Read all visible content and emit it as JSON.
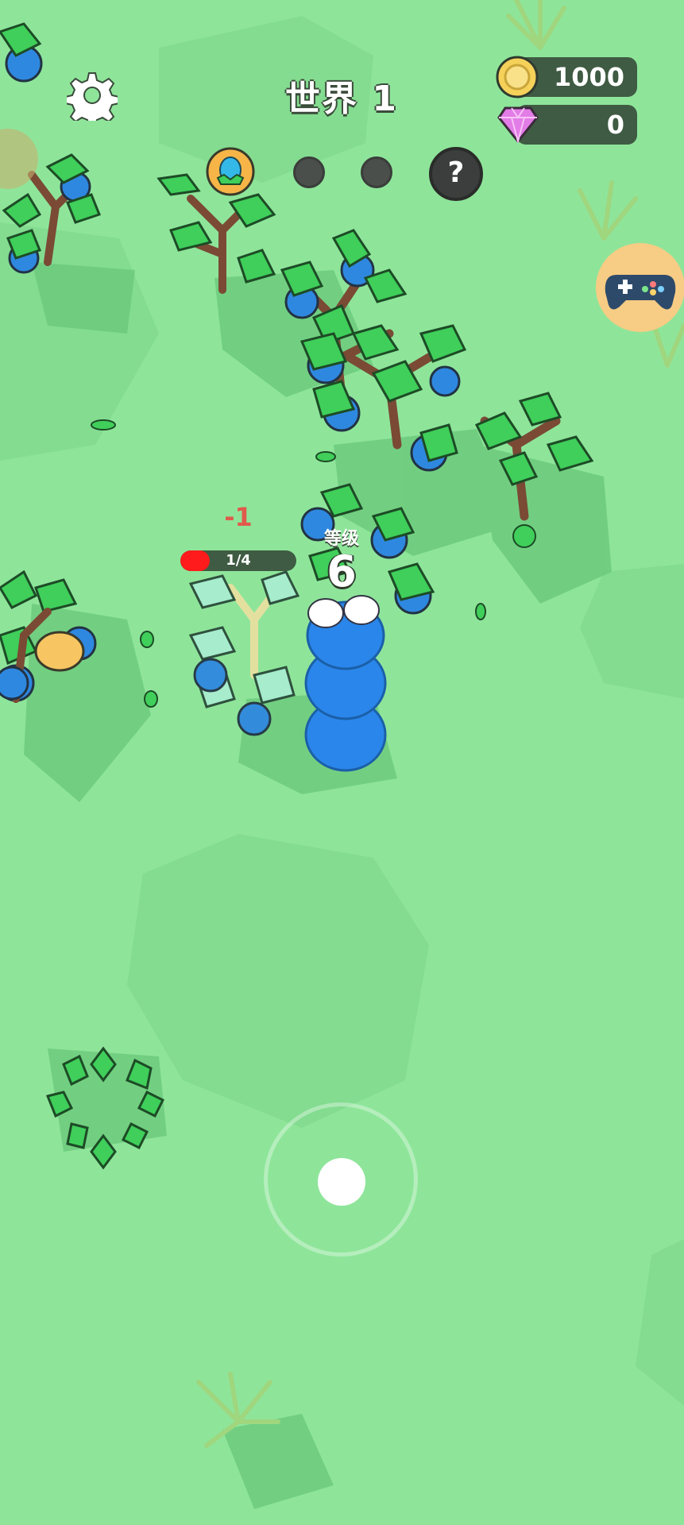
{
  "header": {
    "world_title": "世界 1",
    "coins": "1000",
    "gems": "0"
  },
  "player": {
    "level_label": "等级",
    "level": "6"
  },
  "target": {
    "damage_text": "-1",
    "hp_text": "1/4",
    "hp_fraction": 0.25
  },
  "icons": {
    "settings": "gear-icon",
    "coin": "coin-icon",
    "gem": "gem-icon",
    "help": "question-icon",
    "gamepad": "gamepad-icon",
    "egg_reward": "egg-icon"
  },
  "help_symbol": "?",
  "colors": {
    "ground": "#8ee59a",
    "leaf": "#3fcf5a",
    "berry": "#2f88e0",
    "worm": "#2a86ea",
    "hp": "#ff1b1b"
  }
}
